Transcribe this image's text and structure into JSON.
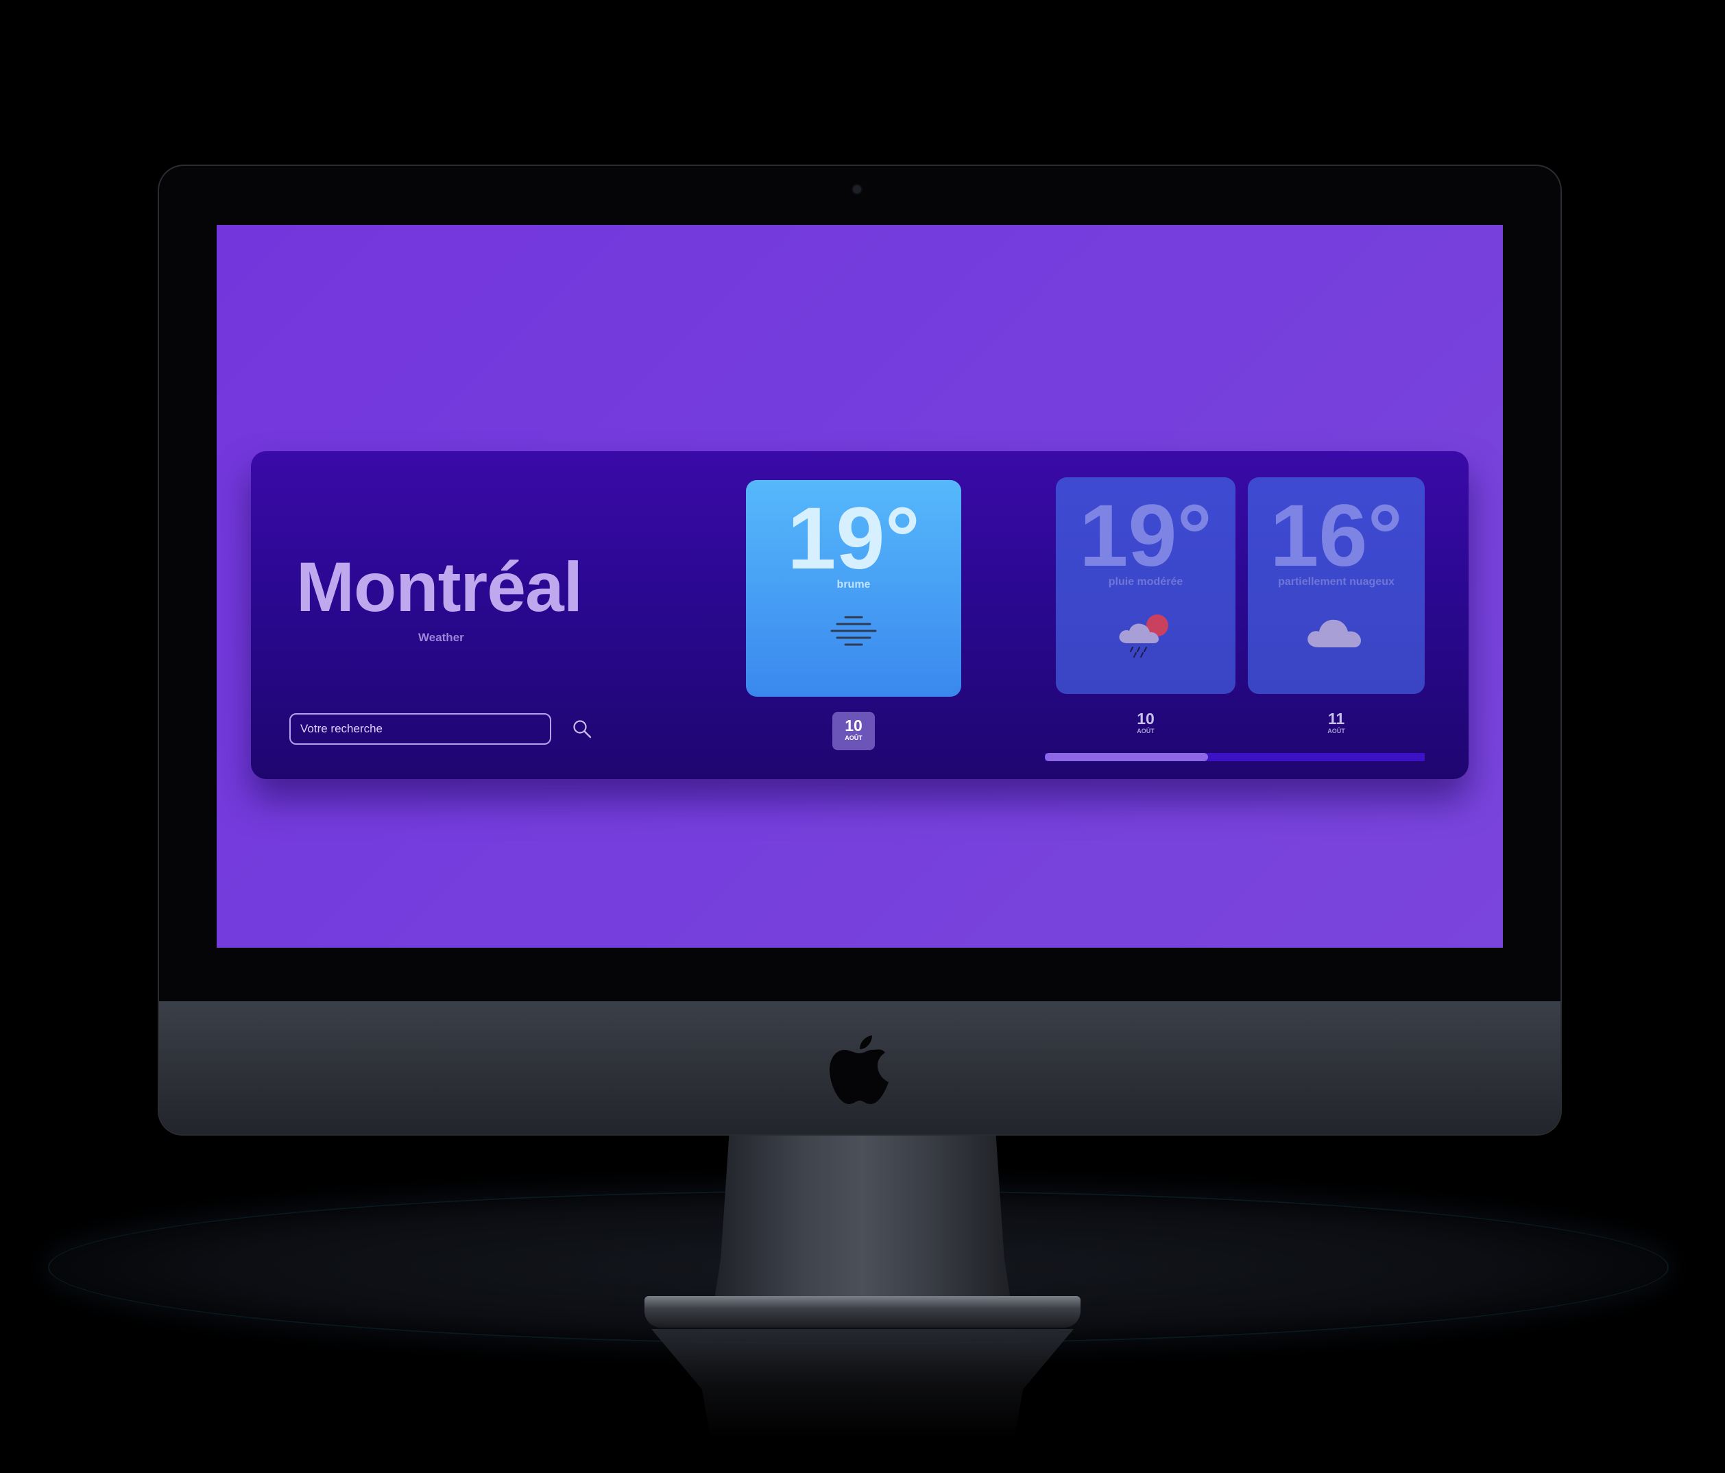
{
  "app": {
    "city": "Montréal",
    "subtitle": "Weather",
    "search": {
      "placeholder": "Votre recherche"
    }
  },
  "forecast": [
    {
      "temp": "19°",
      "description": "brume",
      "icon": "fog-icon",
      "day": "10",
      "month": "AOÛT",
      "selected": true
    },
    {
      "temp": "19°",
      "description": "pluie modérée",
      "icon": "rain-cloud-sun-icon",
      "day": "10",
      "month": "AOÛT",
      "selected": false
    },
    {
      "temp": "16°",
      "description": "partiellement nuageux",
      "icon": "cloud-icon",
      "day": "11",
      "month": "AOÛT",
      "selected": false
    }
  ],
  "scroll": {
    "position_fraction": 0.43
  },
  "colors": {
    "screen_bg": "#7336dc",
    "card_bg": "#2a0890",
    "active_card": "#4aa2f5",
    "dim_card": "#3c47cc",
    "accent_text": "#c0a8ee"
  }
}
